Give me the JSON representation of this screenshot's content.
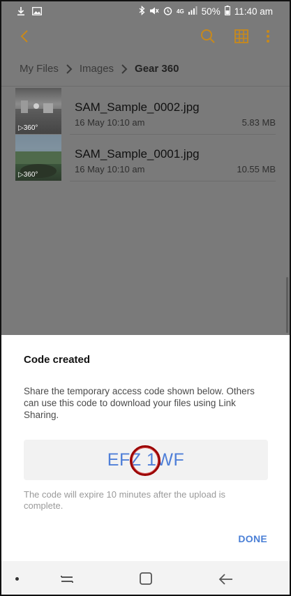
{
  "status_bar": {
    "battery": "50%",
    "time": "11:40 am",
    "network": "4G",
    "left_icons": [
      "download-icon",
      "image-icon"
    ],
    "right_icons": [
      "bluetooth-icon",
      "mute-icon",
      "alarm-icon",
      "signal-icon",
      "battery-icon"
    ]
  },
  "app_bar": {
    "icons": [
      "back-icon",
      "search-icon",
      "grid-view-icon",
      "more-icon"
    ],
    "accent_color": "#c8891b"
  },
  "breadcrumb": {
    "items": [
      "My Files",
      "Images",
      "Gear 360"
    ]
  },
  "files": [
    {
      "name": "SAM_Sample_0002.jpg",
      "date": "16 May 10:10 am",
      "size": "5.83 MB",
      "badge": "▷360°"
    },
    {
      "name": "SAM_Sample_0001.jpg",
      "date": "16 May 10:10 am",
      "size": "10.55 MB",
      "badge": "▷360°"
    }
  ],
  "dialog": {
    "title": "Code created",
    "body": "Share the temporary access code shown below. Others can use this code to download your files using Link Sharing.",
    "code": "EFZ 1WF",
    "note": "The code will expire 10 minutes after the upload is complete.",
    "done_label": "DONE",
    "accent_color": "#4a7fd6"
  },
  "nav_bar": {
    "icons": [
      "recent-apps-icon",
      "home-icon",
      "back-icon"
    ]
  }
}
